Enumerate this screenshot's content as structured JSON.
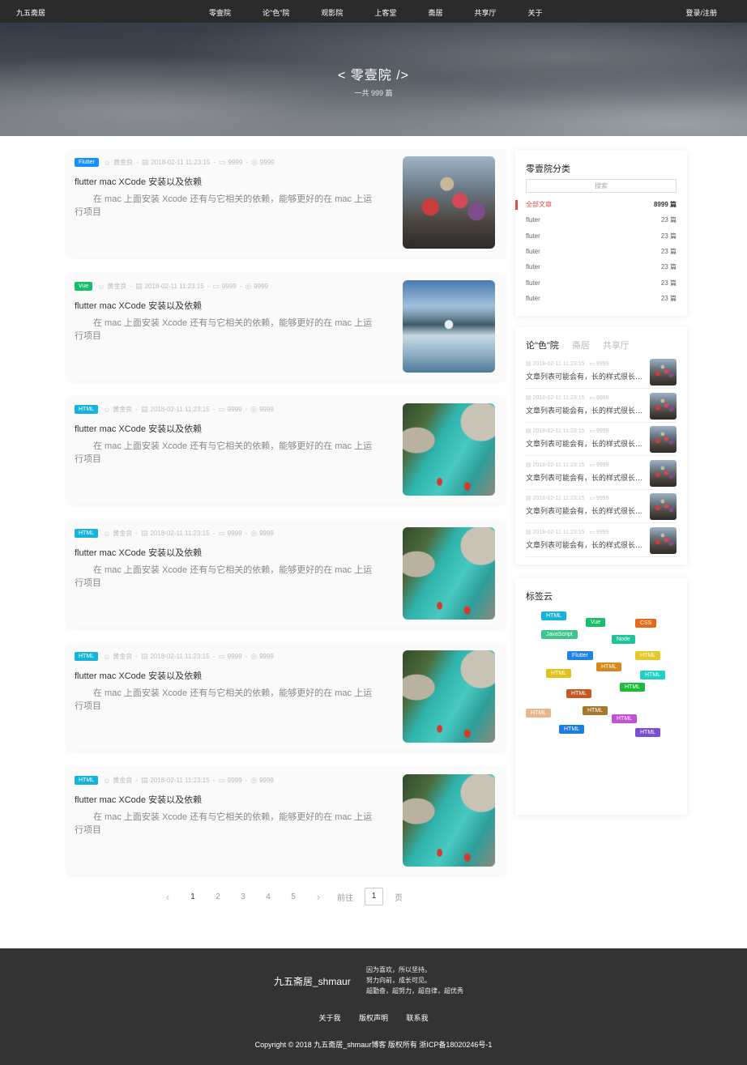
{
  "topnav": {
    "brand": "九五斋居",
    "items": [
      "零壹院",
      "论\"色\"院",
      "观影院",
      "上客堂",
      "斋居",
      "共享厅",
      "关于"
    ],
    "login": "登录/注册"
  },
  "hero": {
    "title": "< 零壹院 />",
    "count": "一共 999 篇"
  },
  "articles": [
    {
      "tag": "Flutter",
      "tag_color": "#1890ff",
      "author": "黄金良",
      "date": "2018-02-11 11:23:15",
      "comments": "9999",
      "views": "9999",
      "title": "flutter mac XCode 安装以及依赖",
      "desc": "在 mac 上面安装 Xcode 还有与它相关的依赖，能够更好的在 mac 上运行项目",
      "image": "crowd-photo"
    },
    {
      "tag": "Vue",
      "tag_color": "#19be6b",
      "author": "黄金良",
      "date": "2018-02-11 11:23:15",
      "comments": "9999",
      "views": "9999",
      "title": "flutter mac XCode 安装以及依赖",
      "desc": "在 mac 上面安装 Xcode 还有与它相关的依赖，能够更好的在 mac 上运行项目",
      "image": "lake-photo"
    },
    {
      "tag": "HTML",
      "tag_color": "#17b3d8",
      "author": "黄金良",
      "date": "2018-02-11 11:23:15",
      "comments": "9999",
      "views": "9999",
      "title": "flutter mac XCode 安装以及依赖",
      "desc": "在 mac 上面安装 Xcode 还有与它相关的依赖，能够更好的在 mac 上运行项目",
      "image": "river-photo"
    },
    {
      "tag": "HTML",
      "tag_color": "#17b3d8",
      "author": "黄金良",
      "date": "2018-02-11 11:23:15",
      "comments": "9999",
      "views": "9999",
      "title": "flutter mac XCode 安装以及依赖",
      "desc": "在 mac 上面安装 Xcode 还有与它相关的依赖，能够更好的在 mac 上运行项目",
      "image": "river-photo"
    },
    {
      "tag": "HTML",
      "tag_color": "#17b3d8",
      "author": "黄金良",
      "date": "2018-02-11 11:23:15",
      "comments": "9999",
      "views": "9999",
      "title": "flutter mac XCode 安装以及依赖",
      "desc": "在 mac 上面安装 Xcode 还有与它相关的依赖，能够更好的在 mac 上运行项目",
      "image": "river-photo"
    },
    {
      "tag": "HTML",
      "tag_color": "#17b3d8",
      "author": "黄金良",
      "date": "2018-02-11 11:23:15",
      "comments": "9999",
      "views": "9999",
      "title": "flutter mac XCode 安装以及依赖",
      "desc": "在 mac 上面安装 Xcode 还有与它相关的依赖，能够更好的在 mac 上运行项目",
      "image": "river-photo"
    }
  ],
  "pagination": {
    "prev": "‹",
    "pages": [
      "1",
      "2",
      "3",
      "4",
      "5"
    ],
    "current": "1",
    "next": "›",
    "goto_label": "前往",
    "goto_value": "1",
    "page_suffix": "页"
  },
  "categories": {
    "title": "零壹院分类",
    "search_placeholder": "搜索",
    "items": [
      {
        "name": "全部文章",
        "count": "8999 篇",
        "active": true
      },
      {
        "name": "fluter",
        "count": "23 篇",
        "active": false
      },
      {
        "name": "fluter",
        "count": "23 篇",
        "active": false
      },
      {
        "name": "fluter",
        "count": "23 篇",
        "active": false
      },
      {
        "name": "fluter",
        "count": "23 篇",
        "active": false
      },
      {
        "name": "fluter",
        "count": "23 篇",
        "active": false
      },
      {
        "name": "fluter",
        "count": "23 篇",
        "active": false
      }
    ]
  },
  "recent": {
    "tabs": [
      "论\"色\"院",
      "斋居",
      "共享厅"
    ],
    "active_tab": 0,
    "items": [
      {
        "date": "2018-02-11 11:23:15",
        "comments": "9999",
        "title": "文章列表可能会有，长的样式很长很长"
      },
      {
        "date": "2018-02-11 11:23:15",
        "comments": "9999",
        "title": "文章列表可能会有，长的样式很长很长"
      },
      {
        "date": "2018-02-11 11:23:15",
        "comments": "9999",
        "title": "文章列表可能会有，长的样式很长很长"
      },
      {
        "date": "2018-02-11 11:23:15",
        "comments": "9999",
        "title": "文章列表可能会有，长的样式很长很长"
      },
      {
        "date": "2018-02-11 11:23:15",
        "comments": "9999",
        "title": "文章列表可能会有，长的样式很长很长"
      },
      {
        "date": "2018-02-11 11:23:15",
        "comments": "9999",
        "title": "文章列表可能会有，长的样式很长很长"
      }
    ]
  },
  "tagcloud": {
    "title": "标签云",
    "tags": [
      {
        "label": "HTML",
        "color": "#17b3d8"
      },
      {
        "label": "Vue",
        "color": "#19be6b"
      },
      {
        "label": "CSS",
        "color": "#e46a1a"
      },
      {
        "label": "JavaScript",
        "color": "#3cc58c"
      },
      {
        "label": "Node",
        "color": "#20c29b"
      },
      {
        "label": "Flutter",
        "color": "#1e82e6"
      },
      {
        "label": "HTML",
        "color": "#e8c825"
      },
      {
        "label": "HTML",
        "color": "#d9881e"
      },
      {
        "label": "HTML",
        "color": "#e2c21a"
      },
      {
        "label": "HTML",
        "color": "#20d0c8"
      },
      {
        "label": "HTML",
        "color": "#1ebc3a"
      },
      {
        "label": "HTML",
        "color": "#c25a22"
      },
      {
        "label": "HTML",
        "color": "#e6b88a"
      },
      {
        "label": "HTML",
        "color": "#a5782c"
      },
      {
        "label": "HTML",
        "color": "#c253d6"
      },
      {
        "label": "HTML",
        "color": "#1a7ee0"
      },
      {
        "label": "HTML",
        "color": "#7a4fd2"
      }
    ]
  },
  "footer": {
    "brand": "九五斋居_shmaur",
    "motto": [
      "因为喜欢，所以坚持。",
      "努力向前，成长可见。",
      "超勤奋，超努力，超自律，超优秀"
    ],
    "links": [
      "关于我",
      "版权声明",
      "联系我"
    ],
    "copyright": "Copyright © 2018 九五斋居_shmaur博客 版权所有 浙ICP备18020246号-1"
  }
}
